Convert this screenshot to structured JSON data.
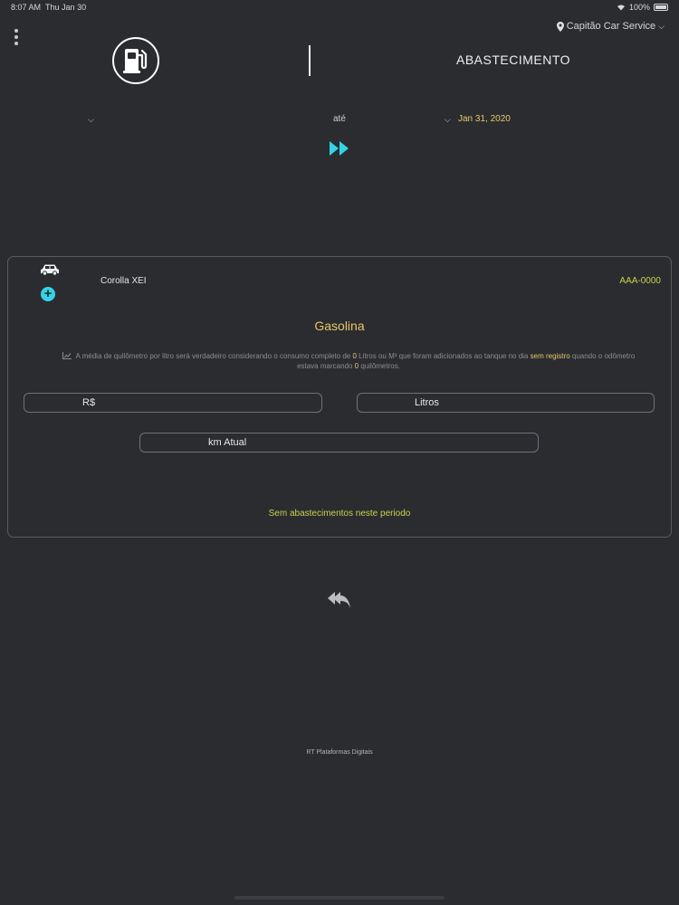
{
  "status": {
    "time": "8:07 AM",
    "date": "Thu Jan 30",
    "battery": "100%"
  },
  "header": {
    "location": "Capitão Car Service",
    "title": "ABASTECIMENTO"
  },
  "date_range": {
    "start": "",
    "separator": "até",
    "end": "Jan 31, 2020"
  },
  "vehicle": {
    "name": "Corolla XEI",
    "plate": "AAA-0000",
    "fuel_type": "Gasolina"
  },
  "info": {
    "part1": "A média de quilômetro por litro será verdadeiro considerando o consumo completo de",
    "liters": "0",
    "part2": "Litros ou M³ que foram adicionados ao tanque no dia",
    "day": "sem registro",
    "part3": "quando o odômetro estava marcando",
    "km": "0",
    "part4": "quilômetros."
  },
  "fields": {
    "price_placeholder": "R$",
    "liters_placeholder": "Litros",
    "km_placeholder": "km Atual"
  },
  "empty_message": "Sem abastecimentos neste periodo",
  "footer": "RT Plataformas Digitais",
  "colors": {
    "accent": "#35d3e6",
    "highlight": "#e6c86a",
    "lime": "#c8d24a",
    "background": "#2b2c30"
  }
}
